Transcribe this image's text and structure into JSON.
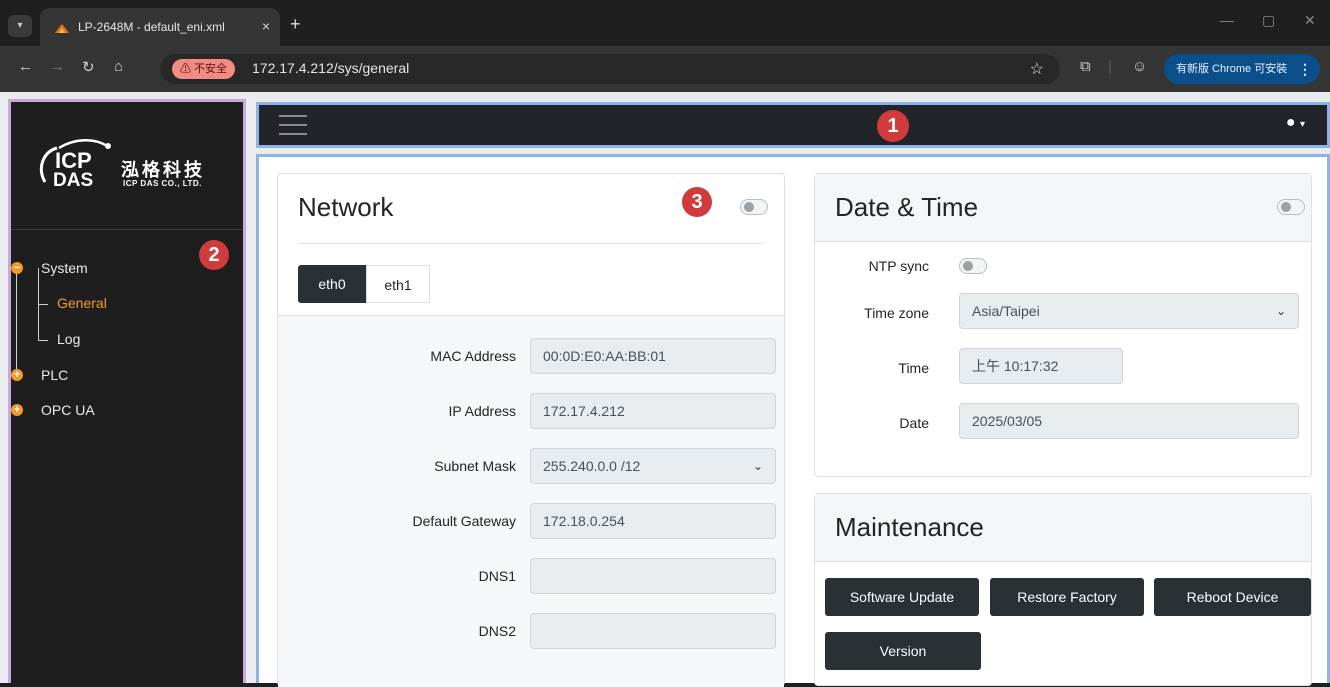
{
  "browser": {
    "tab_title": "LP-2648M - default_eni.xml",
    "tab_close": "×",
    "new_tab": "+",
    "security_chip": "⚠ 不安全",
    "url": "172.17.4.212/sys/general",
    "update_chip": "有新版 Chrome 可安裝",
    "update_menu": "⋮"
  },
  "logo": {
    "mark_line1": "ICP",
    "mark_line2": "DAS",
    "name_cn": "泓格科技",
    "name_en": "ICP DAS CO., LTD."
  },
  "callouts": {
    "one": "1",
    "two": "2",
    "three": "3"
  },
  "sidebar": {
    "items": [
      {
        "label": "System",
        "color": "#eaeaea"
      },
      {
        "label": "General",
        "color": "#f19a2b"
      },
      {
        "label": "Log",
        "color": "#eaeaea"
      },
      {
        "label": "PLC",
        "color": "#eaeaea"
      },
      {
        "label": "OPC UA",
        "color": "#eaeaea"
      }
    ]
  },
  "network": {
    "title": "Network",
    "tabs": [
      "eth0",
      "eth1"
    ],
    "active_tab": "eth0",
    "fields": [
      {
        "label": "MAC Address",
        "value": "00:0D:E0:AA:BB:01"
      },
      {
        "label": "IP Address",
        "value": "172.17.4.212"
      },
      {
        "label": "Subnet Mask",
        "value": "255.240.0.0 /12"
      },
      {
        "label": "Default Gateway",
        "value": "172.18.0.254"
      },
      {
        "label": "DNS1",
        "value": ""
      },
      {
        "label": "DNS2",
        "value": ""
      }
    ]
  },
  "datetime": {
    "title": "Date & Time",
    "fields": [
      {
        "label": "NTP sync",
        "value": ""
      },
      {
        "label": "Time zone",
        "value": "Asia/Taipei"
      },
      {
        "label": "Time",
        "value": "上午 10:17:32"
      },
      {
        "label": "Date",
        "value": "2025/03/05"
      }
    ]
  },
  "maintenance": {
    "title": "Maintenance",
    "buttons": [
      "Software Update",
      "Restore Factory",
      "Reboot Device",
      "Version"
    ]
  },
  "colors": {
    "accent_orange": "#f19a2b",
    "callout_red": "#d03b3b",
    "dark_button": "#2b3035",
    "outline_blue": "#8fb3e6",
    "outline_purple": "#c9a8e0"
  }
}
